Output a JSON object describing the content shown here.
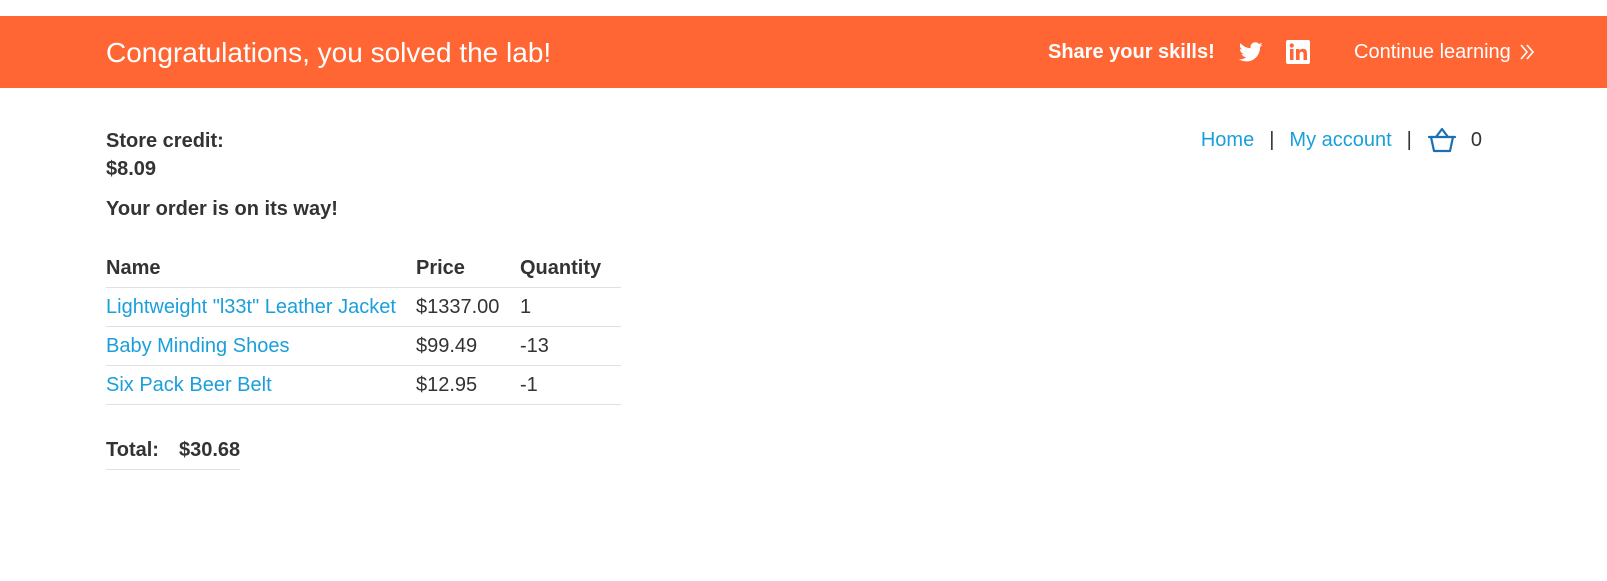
{
  "banner": {
    "title": "Congratulations, you solved the lab!",
    "share_label": "Share your skills!",
    "twitter_icon": "twitter-icon",
    "linkedin_icon": "linkedin-icon",
    "continue_label": "Continue learning",
    "background_color": "#ff6633"
  },
  "nav": {
    "home_label": "Home",
    "separator": "|",
    "account_label": "My account",
    "cart_icon": "basket-icon",
    "cart_count": "0",
    "link_color": "#1a9fdb"
  },
  "account": {
    "store_credit_label": "Store credit:",
    "store_credit_value": "$8.09"
  },
  "order": {
    "message": "Your order is on its way!",
    "columns": [
      "Name",
      "Price",
      "Quantity"
    ],
    "rows": [
      {
        "name": "Lightweight \"l33t\" Leather Jacket",
        "price": "$1337.00",
        "quantity": "1"
      },
      {
        "name": "Baby Minding Shoes",
        "price": "$99.49",
        "quantity": "-13"
      },
      {
        "name": "Six Pack Beer Belt",
        "price": "$12.95",
        "quantity": "-1"
      }
    ],
    "total_label": "Total:",
    "total_value": "$30.68"
  }
}
